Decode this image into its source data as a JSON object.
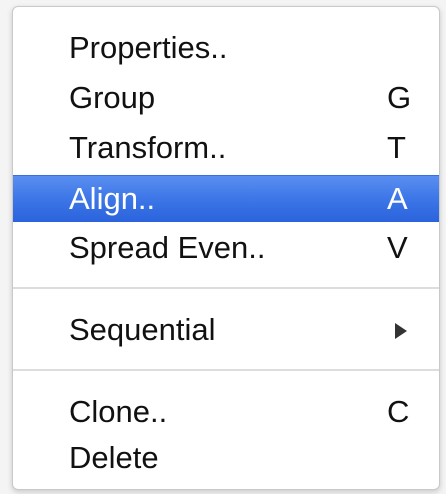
{
  "menu": {
    "items": [
      {
        "label": "Properties..",
        "shortcut": ""
      },
      {
        "label": "Group",
        "shortcut": "G"
      },
      {
        "label": "Transform..",
        "shortcut": "T"
      },
      {
        "label": "Align..",
        "shortcut": "A",
        "highlighted": true
      },
      {
        "label": "Spread Even..",
        "shortcut": "V"
      },
      {
        "label": "Sequential",
        "submenu_icon": "submenu-arrow-icon"
      },
      {
        "label": "Clone..",
        "shortcut": "C"
      },
      {
        "label": "Delete",
        "shortcut": ""
      }
    ]
  },
  "colors": {
    "highlight": "#3f78e8",
    "text": "#111111",
    "highlight_text": "#ffffff",
    "separator": "#dddddd"
  }
}
